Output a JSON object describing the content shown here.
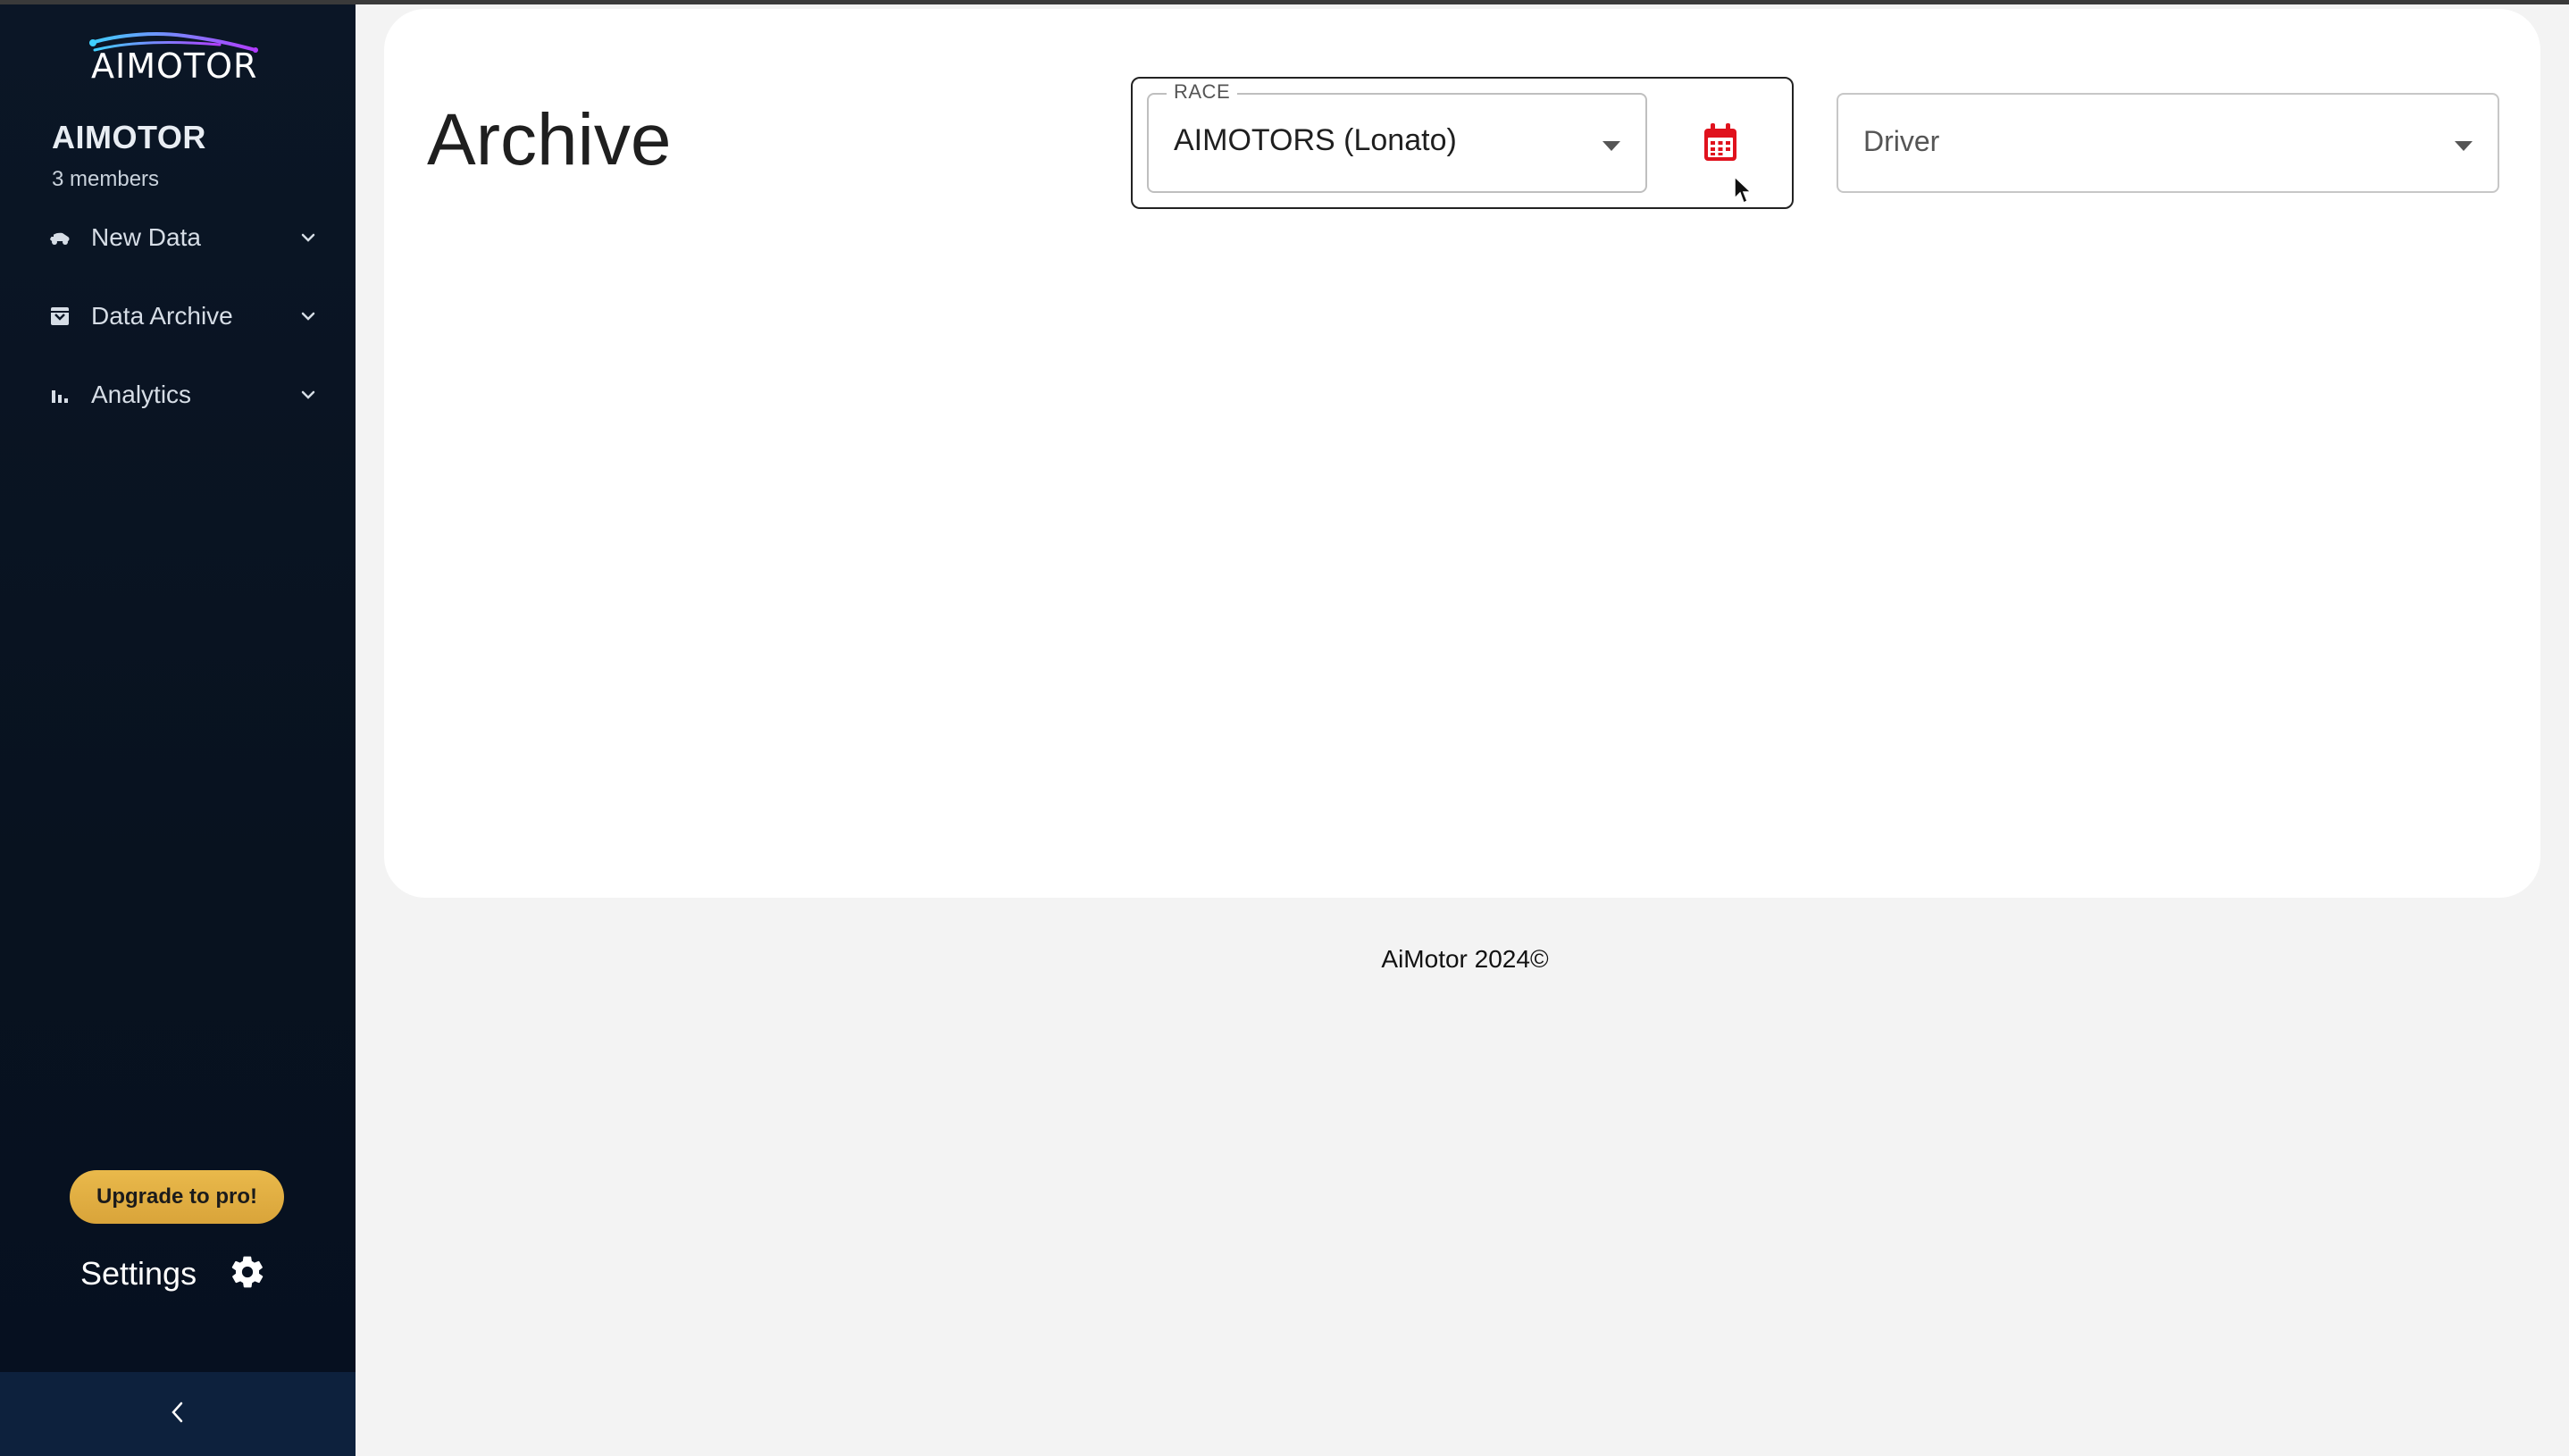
{
  "sidebar": {
    "logo_text": "AIMOTOR",
    "org_name": "AIMOTOR",
    "members": "3 members",
    "items": [
      {
        "label": "New Data",
        "icon": "car-icon"
      },
      {
        "label": "Data Archive",
        "icon": "archive-icon"
      },
      {
        "label": "Analytics",
        "icon": "bar-chart-icon"
      }
    ],
    "upgrade_label": "Upgrade to pro!",
    "settings_label": "Settings",
    "settings_icon": "gear-icon",
    "collapse_icon": "chevron-left-icon"
  },
  "main": {
    "title": "Archive",
    "race": {
      "label": "RACE",
      "value": "AIMOTORS (Lonato)",
      "calendar_icon": "calendar-icon",
      "calendar_color": "#e0121d"
    },
    "driver": {
      "placeholder": "Driver"
    }
  },
  "footer": {
    "text": "AiMotor 2024©"
  },
  "colors": {
    "sidebar_bg": "#0b1626",
    "accent_gold": "#e2b046",
    "logo_gradient_start": "#3fd0ff",
    "logo_gradient_end": "#b23cff"
  }
}
